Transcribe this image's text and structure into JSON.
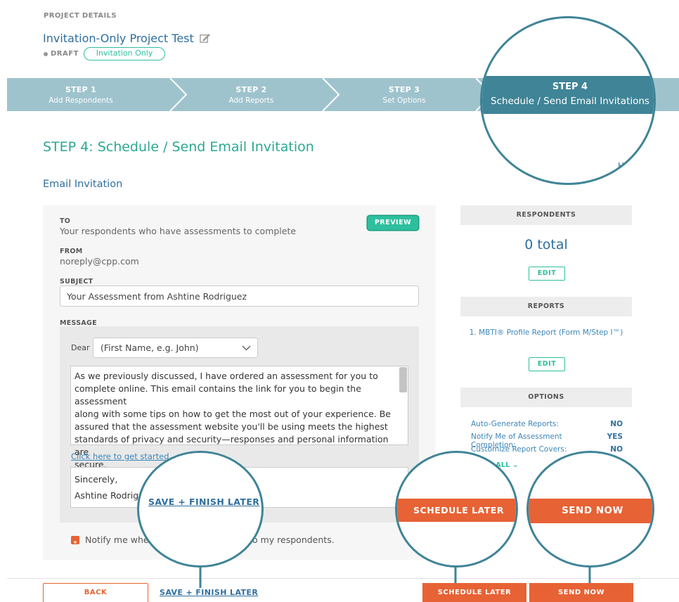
{
  "header": {
    "section_label": "PROJECT DETAILS",
    "project_title": "Invitation-Only Project Test",
    "status": "DRAFT",
    "badge": "Invitation Only"
  },
  "steps": [
    {
      "num": "STEP 1",
      "label": "Add Respondents"
    },
    {
      "num": "STEP 2",
      "label": "Add Reports"
    },
    {
      "num": "STEP 3",
      "label": "Set Options"
    },
    {
      "num": "STEP 4",
      "label": "Schedule / Send Email Invitations"
    }
  ],
  "page_title": "STEP 4: Schedule / Send Email Invitation",
  "section_title": "Email Invitation",
  "form": {
    "to_label": "TO",
    "to_value": "Your respondents who have assessments to complete",
    "preview": "PREVIEW",
    "from_label": "FROM",
    "from_value": "noreply@cpp.com",
    "subject_label": "SUBJECT",
    "subject_value": "Your Assessment from Ashtine Rodriguez",
    "message_label": "MESSAGE",
    "dear_label": "Dear",
    "dear_selected": "(First Name, e.g. John)",
    "message_lines": [
      "As we previously discussed, I have ordered an assessment for you to",
      "complete online. This email contains the link for you to begin the assessment",
      "along with some tips on how to get the most out of your experience. Be",
      "assured that the assessment website you'll be using meets the highest",
      "standards of privacy and security—responses and personal information are",
      "secure."
    ],
    "link_text": "Click here to get started.",
    "signoff": "Sincerely,",
    "signname": "Ashtine Rodrigu",
    "notify_pre": "Notify me whe",
    "notify_post": "o my respondents."
  },
  "sidebar": {
    "respondents_header": "RESPONDENTS",
    "respondents_total": "0 total",
    "edit": "EDIT",
    "reports_header": "REPORTS",
    "report_item": "1. MBTI® Profile Report (Form M/Step I™)",
    "options_header": "OPTIONS",
    "options": [
      {
        "label": "Auto-Generate Reports:",
        "value": "NO"
      },
      {
        "label": "Notify Me of Assessment Completion:",
        "value": "YES"
      },
      {
        "label": "Customize Report Covers:",
        "value": "NO"
      }
    ],
    "show_all": "ALL"
  },
  "footer": {
    "back": "BACK",
    "save_finish": "SAVE + FINISH LATER",
    "schedule_later": "SCHEDULE LATER",
    "send_now": "SEND NOW"
  },
  "callouts": {
    "step4_num": "STEP 4",
    "step4_label": "Schedule / Send Email Invitations",
    "save_finish": "SAVE + FINISH LATER",
    "schedule_later": "SCHEDULE LATER",
    "send_now": "SEND NOW"
  },
  "colors": {
    "teal": "#2ebf9e",
    "orange": "#e76235",
    "step_bar": "#9fc3cd",
    "step_active": "#3f8497",
    "link_blue": "#2f6f9f"
  }
}
